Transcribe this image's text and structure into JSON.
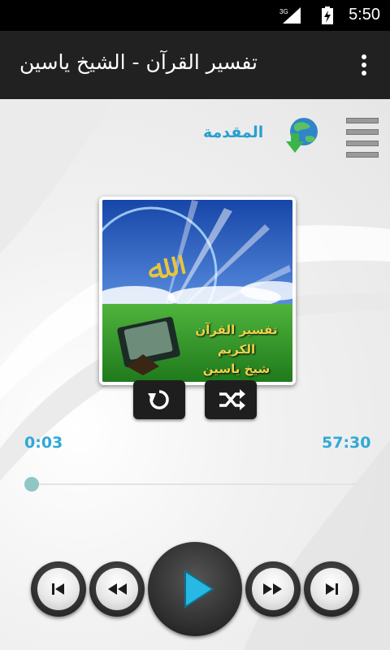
{
  "status_bar": {
    "time": "5:50",
    "network": "3G"
  },
  "app_bar": {
    "title": "تفسير القرآن - الشيخ ياسين"
  },
  "toolbar": {
    "intro_label": "المقدمة"
  },
  "cover": {
    "line1": "تفسير القرآن الكريم",
    "line2": "شيخ ياسين"
  },
  "player": {
    "current_time": "0:03",
    "duration": "57:30",
    "progress": 0.001
  },
  "colors": {
    "accent": "#2fa9d6",
    "appbar": "#212121",
    "play_icon": "#27b8e3"
  },
  "icons": [
    "overflow-menu-icon",
    "menu-list-icon",
    "download-globe-icon",
    "repeat-icon",
    "shuffle-icon",
    "skip-previous-icon",
    "rewind-icon",
    "play-icon",
    "fast-forward-icon",
    "skip-next-icon"
  ]
}
